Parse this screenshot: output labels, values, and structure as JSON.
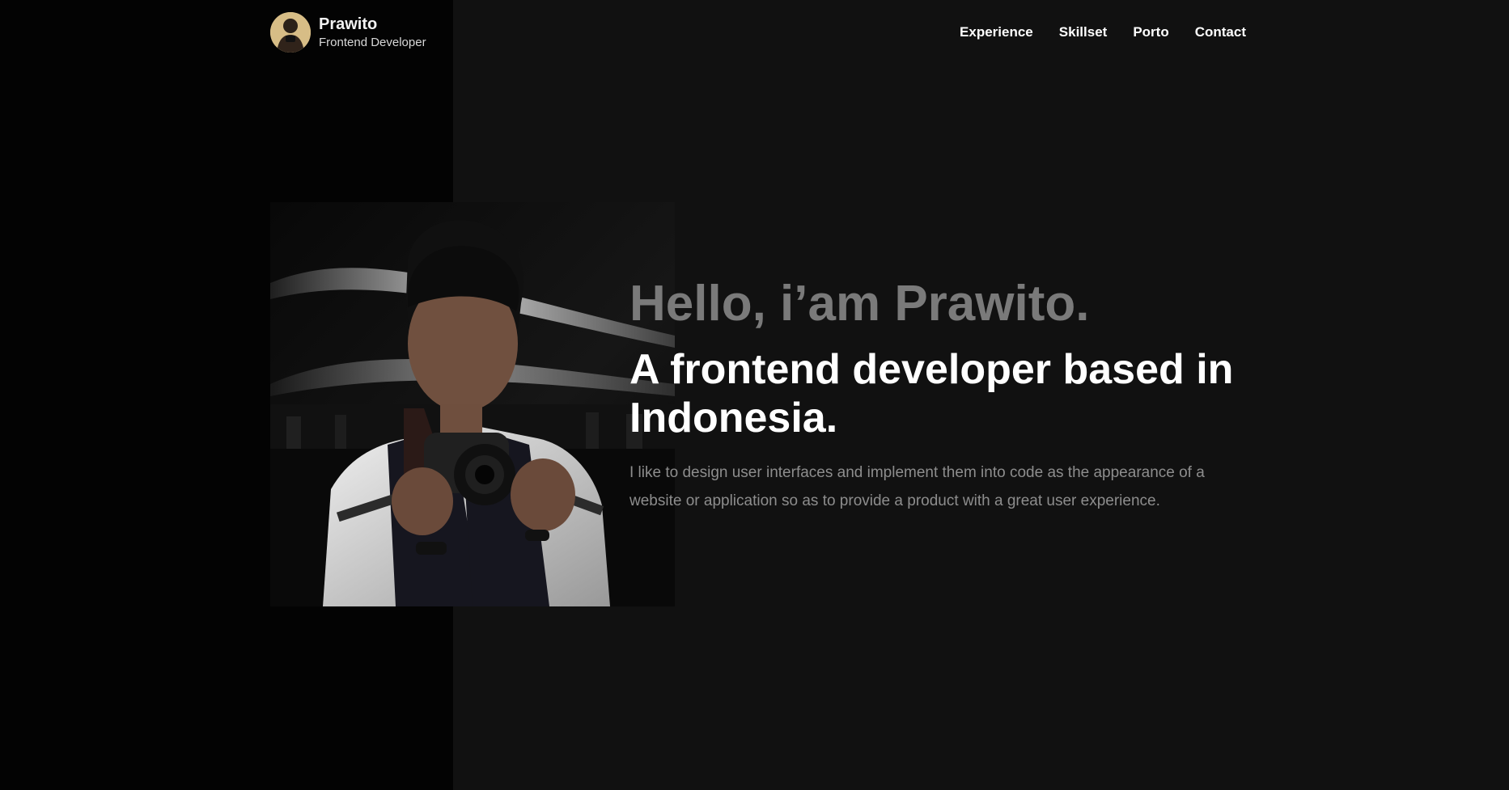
{
  "brand": {
    "name": "Prawito",
    "role": "Frontend Developer",
    "avatar_icon": "profile-avatar-icon"
  },
  "nav": {
    "items": [
      {
        "label": "Experience"
      },
      {
        "label": "Skillset"
      },
      {
        "label": "Porto"
      },
      {
        "label": "Contact"
      }
    ]
  },
  "hero": {
    "greeting": "Hello, i’am Prawito.",
    "headline": "A frontend developer based in Indonesia.",
    "description": "I like to design user interfaces and implement them into code as the appearance of a website or application so as to provide a product with a great user experience.",
    "photo_icon": "photographer-portrait-image"
  },
  "colors": {
    "background": "#111111",
    "left_band": "#030303",
    "greeting": "#7a7a7a",
    "headline": "#ffffff",
    "description": "#8d8d8d"
  }
}
